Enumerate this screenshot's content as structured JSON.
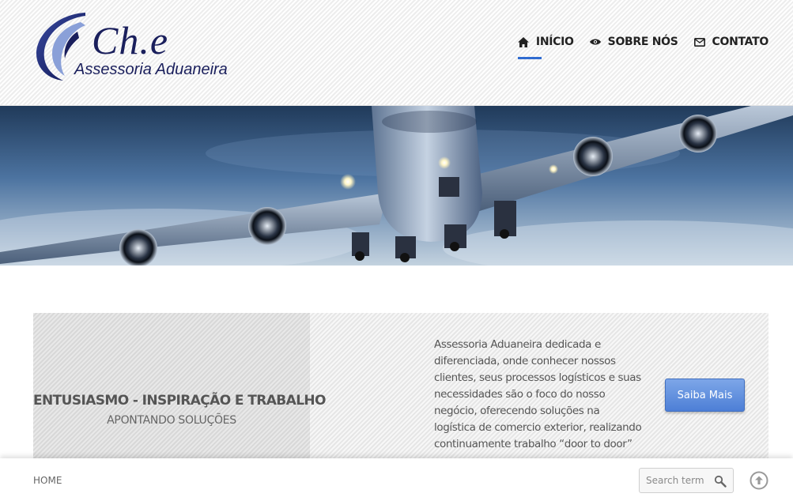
{
  "header": {
    "logo": {
      "mark": "Ch.e",
      "subtitle": "Assessoria Aduaneira"
    },
    "nav": [
      {
        "label": "INÍCIO",
        "icon": "home-icon",
        "active": true
      },
      {
        "label": "SOBRE NÓS",
        "icon": "eye-icon",
        "active": false
      },
      {
        "label": "CONTATO",
        "icon": "envelope-icon",
        "active": false
      }
    ]
  },
  "hero": {
    "image": "airplane-landing-photo"
  },
  "band": {
    "tagline": "ENTUSIASMO - INSPIRAÇÃO E TRABALHO",
    "subtagline": "APONTANDO SOLUÇÕES",
    "description": "Assessoria Aduaneira dedicada e diferenciada, onde conhecer nossos clientes, seus processos logísticos e suas necessidades são o foco do nosso negócio, oferecendo soluções na logística de comercio exterior, realizando continuamente trabalho “door to door”",
    "cta_label": "Saiba Mais"
  },
  "footer": {
    "breadcrumb": "HOME",
    "search_placeholder": "Search term",
    "search_icon": "magnifier-icon",
    "top_icon": "arrow-up-circle-icon"
  },
  "colors": {
    "accent": "#2f6bd0",
    "logo": "#1a1f5c",
    "button": "#5b8ddd"
  }
}
